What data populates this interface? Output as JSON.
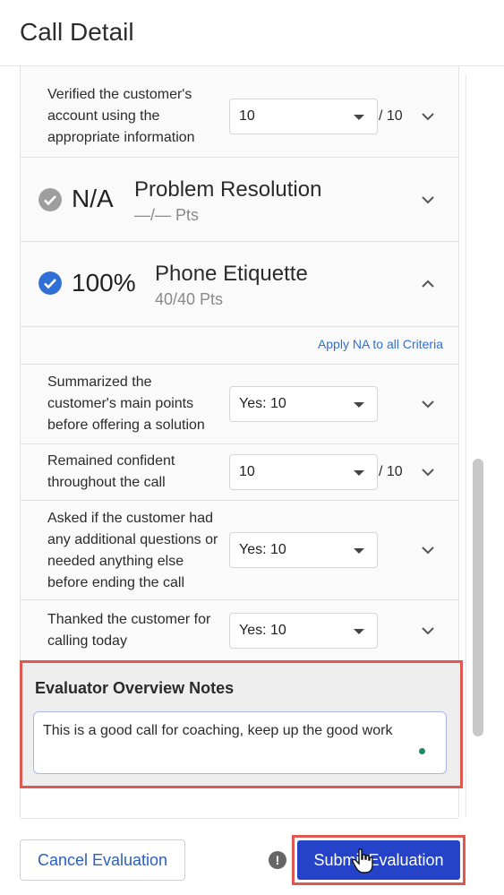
{
  "page": {
    "title": "Call Detail"
  },
  "criteria_top": {
    "text_lines": [
      "Verified the customer's",
      "account using the",
      "appropriate information"
    ],
    "value": "10",
    "out_of": "/ 10"
  },
  "sections": [
    {
      "score": "N/A",
      "name": "Problem Resolution",
      "pts": "—/— Pts",
      "status_color": "#9e9e9e"
    },
    {
      "score": "100%",
      "name": "Phone Etiquette",
      "pts": "40/40 Pts",
      "status_color": "#2f6fd6"
    }
  ],
  "apply_na_label": "Apply NA to all Criteria",
  "criteria": [
    {
      "text_lines": [
        "Summarized the",
        "customer's main points",
        "before offering a solution"
      ],
      "value": "Yes: 10",
      "out_of": ""
    },
    {
      "text_lines": [
        "Remained confident",
        "throughout the call"
      ],
      "value": "10",
      "out_of": "/ 10"
    },
    {
      "text_lines": [
        "Asked if the customer had",
        "any additional questions or",
        "needed anything else",
        "before ending the call"
      ],
      "value": "Yes: 10",
      "out_of": ""
    },
    {
      "text_lines": [
        "Thanked the customer for",
        "calling today"
      ],
      "value": "Yes: 10",
      "out_of": ""
    }
  ],
  "notes": {
    "label": "Evaluator Overview Notes",
    "value": "This is a good call for coaching, keep up the good work"
  },
  "footer": {
    "cancel_label": "Cancel Evaluation",
    "warning_glyph": "!",
    "submit_label": "Submit Evaluation"
  },
  "colors": {
    "accent": "#2443c9",
    "link": "#2f6fd6",
    "highlight": "#e0584f"
  }
}
